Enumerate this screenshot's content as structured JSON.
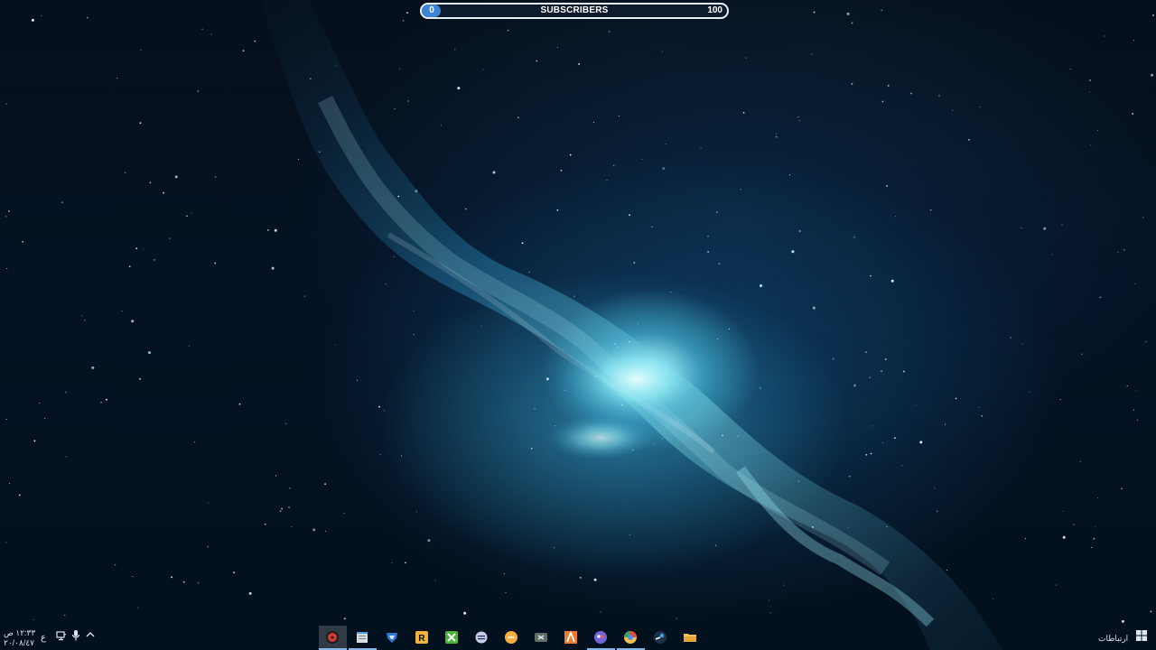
{
  "subscriber_widget": {
    "label": "SUBSCRIBERS",
    "current": "0",
    "goal": "100",
    "progress_fraction": 0.04,
    "fill_color": "#3d84d8"
  },
  "taskbar": {
    "notifications_label": "ارتباطات",
    "clock": {
      "time": "١٢:٣٣ ص",
      "date": "٢٠/٠٨/٤٧"
    },
    "language_indicator": "ع",
    "tray_icons": [
      "chevron-up-icon",
      "microphone-icon",
      "network-icon"
    ],
    "start_icon": "windows-logo-icon",
    "apps": [
      {
        "name": "media-player-icon",
        "color": "#d63b3b",
        "state": "active"
      },
      {
        "name": "notepad-icon",
        "color": "#d8dde2",
        "state": "running"
      },
      {
        "name": "rocket-league-icon",
        "color": "#2a78d2",
        "state": "normal"
      },
      {
        "name": "rockstar-launcher-icon",
        "color": "#f2b13a",
        "state": "normal"
      },
      {
        "name": "xbox-icon",
        "color": "#49b33a",
        "state": "normal"
      },
      {
        "name": "streaming-app-icon",
        "color": "#c7cbe5",
        "state": "normal"
      },
      {
        "name": "chat-app-icon",
        "color": "#f5b03b",
        "state": "normal"
      },
      {
        "name": "xbox-console-icon",
        "color": "#5f6f66",
        "state": "normal"
      },
      {
        "name": "a-app-icon",
        "color": "#ef7b31",
        "state": "normal"
      },
      {
        "name": "media-app-icon",
        "color": "#7365d8",
        "state": "running"
      },
      {
        "name": "browser-icon",
        "color": "#e64b3c",
        "state": "running"
      },
      {
        "name": "steam-icon",
        "color": "#4ba2d8",
        "state": "normal"
      },
      {
        "name": "file-explorer-icon",
        "color": "#f2c354",
        "state": "normal"
      }
    ]
  }
}
